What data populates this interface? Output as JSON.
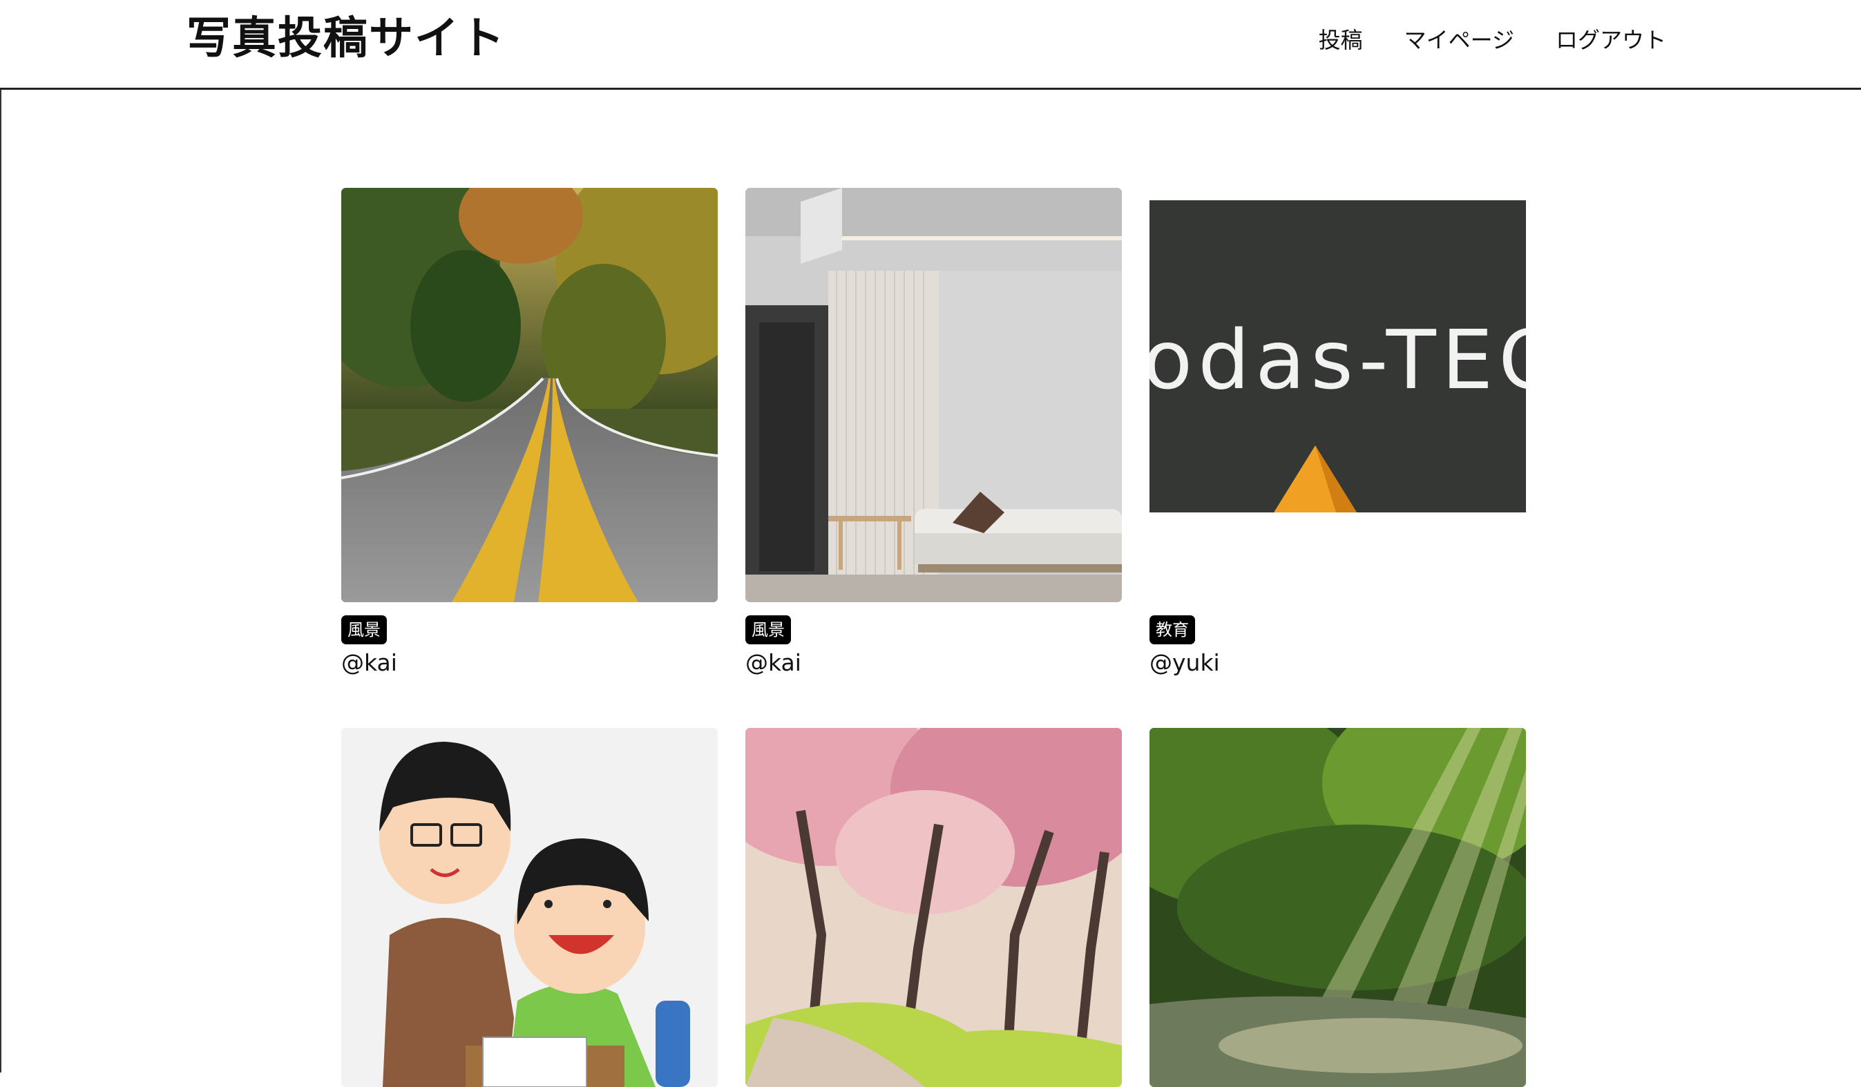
{
  "header": {
    "site_title": "写真投稿サイト",
    "nav": [
      {
        "label": "投稿"
      },
      {
        "label": "マイページ"
      },
      {
        "label": "ログアウト"
      }
    ]
  },
  "posts": [
    {
      "tag": "風景",
      "user": "@kai",
      "image": "autumn forest road"
    },
    {
      "tag": "風景",
      "user": "@kai",
      "image": "modern living room"
    },
    {
      "tag": "教育",
      "user": "@yuki",
      "image": "slate board",
      "image_text": "odas-TEC"
    },
    {
      "tag": "",
      "user": "",
      "image": "teacher and student illustration"
    },
    {
      "tag": "",
      "user": "",
      "image": "cherry blossom path"
    },
    {
      "tag": "",
      "user": "",
      "image": "sunlit forest stream"
    }
  ]
}
